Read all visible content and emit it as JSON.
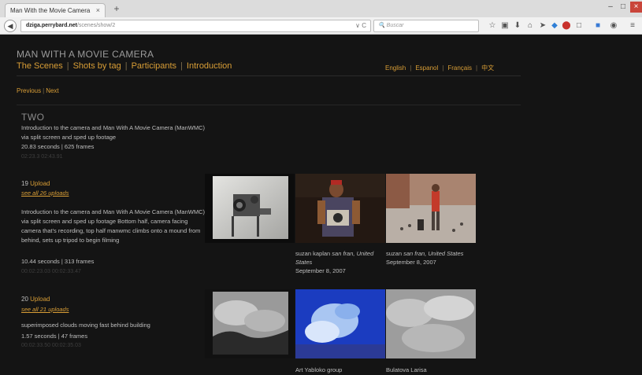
{
  "browser": {
    "tab_title": "Man With the Movie Camera",
    "tab_close": "×",
    "new_tab": "+",
    "url_host": "dziga.perrybard.net",
    "url_path": "/scenes/show/2",
    "url_reload": "∨ C",
    "search_placeholder": "Buscar",
    "back_glyph": "◀",
    "toolbar_icons": [
      "star-icon",
      "clipboard-icon",
      "download-icon",
      "home-icon",
      "pocket-icon",
      "shield-icon",
      "stop-icon",
      "translate-icon",
      "extension-icon",
      "mask-icon",
      "menu-icon"
    ],
    "win_min": "–",
    "win_max": "□",
    "win_close": "×"
  },
  "site": {
    "title": "MAN WITH A MOVIE CAMERA",
    "nav": [
      "The Scenes",
      "Shots by tag",
      "Participants",
      "Introduction"
    ],
    "nav_sep": "|",
    "languages": [
      "English",
      "Espanol",
      "Français",
      "中文"
    ],
    "pager": {
      "previous": "Previous",
      "next": "Next",
      "sep": "|"
    }
  },
  "scene": {
    "name": "TWO",
    "description": "Introduction to the camera and Man With A Movie Camera (ManWMC) via split screen and sped up footage",
    "duration": "20.83 seconds | 625 frames",
    "timecode": "02:23.3 02:43.91"
  },
  "uploads": [
    {
      "number": "19",
      "word": "Upload",
      "link": "see all 26 uploads",
      "description": "Introduction to the camera and Man With A Movie Camera (ManWMC) via split screen and sped up footage Bottom half, camera facing camera that's recording, top half manwmc climbs onto a mound from behind, sets up tripod to begin filming",
      "duration": "10.44 seconds | 313 frames",
      "timecode": "00:02:23.03 00:02:33.47",
      "thumbs": [
        {
          "caption_name": "",
          "caption_place": "",
          "caption_date": ""
        },
        {
          "caption_name": "suzan kaplan",
          "caption_place": "san fran, United States",
          "caption_date": "September 8, 2007"
        },
        {
          "caption_name": "suzan",
          "caption_place": "san fran, United States",
          "caption_date": "September 8, 2007"
        }
      ]
    },
    {
      "number": "20",
      "word": "Upload",
      "link": "see all 21 uploads",
      "description": "superimposed clouds moving fast behind building",
      "duration": "1.57 seconds | 47 frames",
      "timecode": "00:02:33.50 00:02:35.03",
      "thumbs": [
        {
          "caption_name": "",
          "caption_place": "",
          "caption_date": ""
        },
        {
          "caption_name": "Art Yabloko group",
          "caption_place": "",
          "caption_date": ""
        },
        {
          "caption_name": "Bulatova Larisa",
          "caption_place": "",
          "caption_date": ""
        }
      ]
    }
  ],
  "colors": {
    "accent": "#d99e36",
    "background": "#141414",
    "text": "#bfbfbf"
  }
}
